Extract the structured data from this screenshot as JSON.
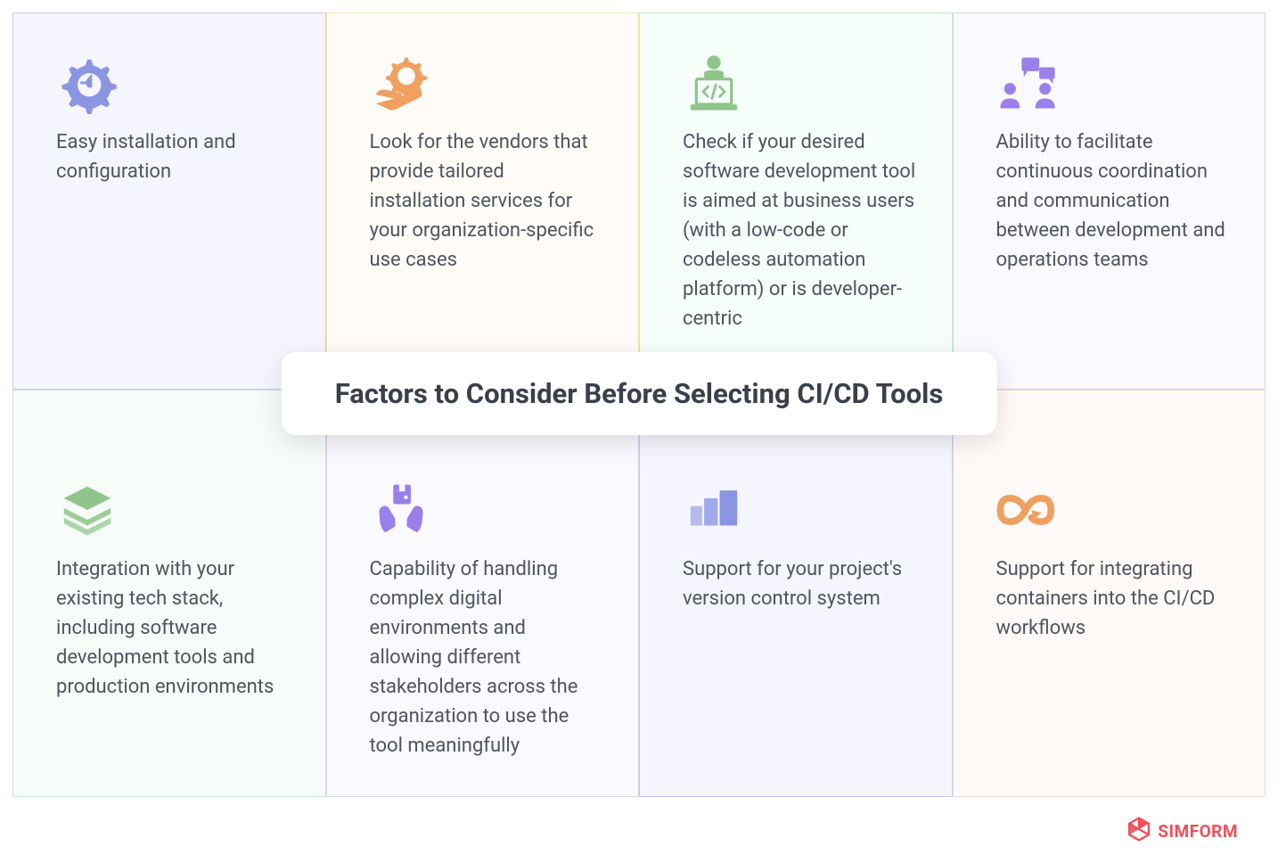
{
  "title": "Factors to Consider Before Selecting CI/CD Tools",
  "cells": [
    {
      "icon": "gear-icon",
      "text": "Easy installation and configuration"
    },
    {
      "icon": "gear-hand-icon",
      "text": "Look for the vendors that provide tailored installation services for your organization-specific use cases"
    },
    {
      "icon": "developer-icon",
      "text": "Check if your desired software development tool is aimed at business users (with a low-code or codeless automation platform) or is developer-centric"
    },
    {
      "icon": "chat-people-icon",
      "text": "Ability to facilitate continuous coordination and communication between development and operations teams"
    },
    {
      "icon": "layers-icon",
      "text": "Integration with your existing tech stack, including software development tools and production environments"
    },
    {
      "icon": "hands-box-icon",
      "text": "Capability of handling complex digital environments and allowing different stakeholders across the organization to use the tool meaningfully"
    },
    {
      "icon": "bars-icon",
      "text": "Support for your project's version control system"
    },
    {
      "icon": "infinity-arrow-icon",
      "text": "Support for integrating containers into the CI/CD workflows"
    }
  ],
  "logo": {
    "brand": "SIMFORM"
  },
  "colors": {
    "blue": "#8b96e3",
    "orange": "#f0a060",
    "green": "#8fc48a",
    "purple": "#9a80eb",
    "red": "#ef4f59",
    "text": "#4e5560"
  }
}
